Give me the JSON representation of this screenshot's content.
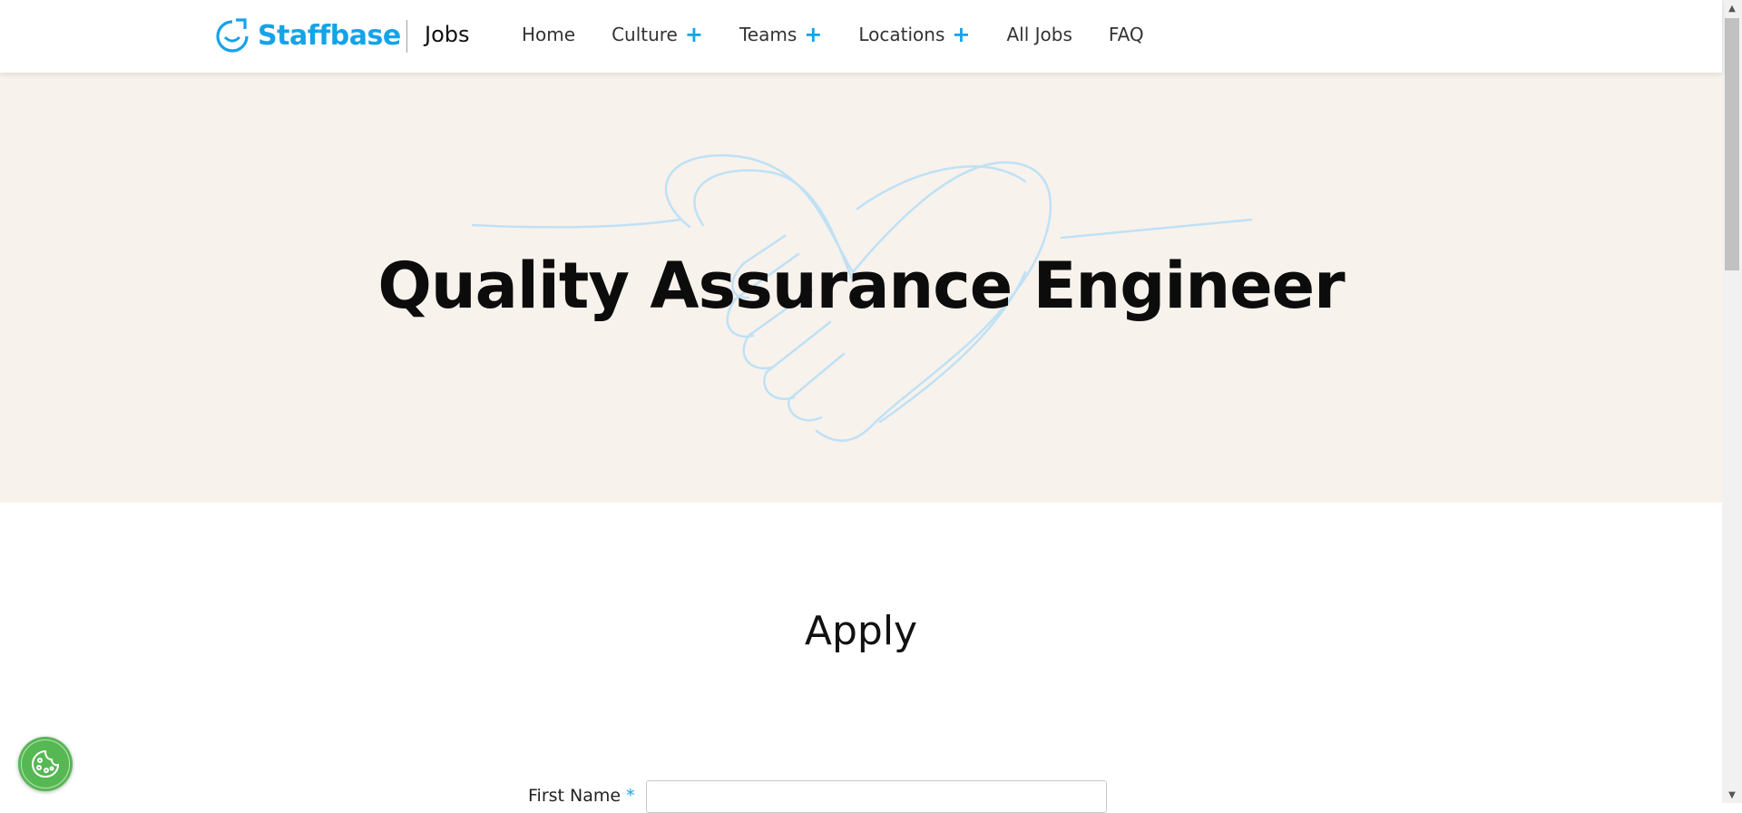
{
  "header": {
    "brand": "Staffbase",
    "section": "Jobs",
    "nav": [
      {
        "label": "Home",
        "expandable": false
      },
      {
        "label": "Culture",
        "expandable": true
      },
      {
        "label": "Teams",
        "expandable": true
      },
      {
        "label": "Locations",
        "expandable": true
      },
      {
        "label": "All Jobs",
        "expandable": false
      },
      {
        "label": "FAQ",
        "expandable": false
      }
    ]
  },
  "hero": {
    "title": "Quality Assurance Engineer",
    "illustration_icon": "heart-handshake-icon"
  },
  "apply": {
    "title": "Apply",
    "first_name_label": "First Name",
    "required_marker": "*"
  },
  "cookie": {
    "icon": "cookie-icon"
  },
  "colors": {
    "accent": "#14a3e8",
    "hero_bg": "#f8f2ec",
    "cookie_bg": "#56b852"
  }
}
